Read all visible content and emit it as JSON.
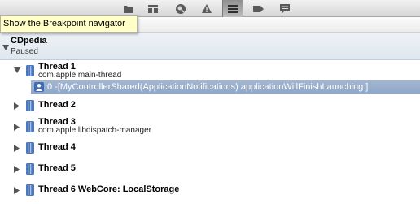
{
  "toolbar": {
    "buttons": [
      {
        "icon": "folder-icon",
        "label": "Project navigator"
      },
      {
        "icon": "hierarchy-icon",
        "label": "Symbol navigator"
      },
      {
        "icon": "search-icon",
        "label": "Search navigator"
      },
      {
        "icon": "warning-icon",
        "label": "Issue navigator"
      },
      {
        "icon": "debug-icon",
        "label": "Debug navigator"
      },
      {
        "icon": "breakpoint-icon",
        "label": "Breakpoint navigator"
      },
      {
        "icon": "log-icon",
        "label": "Log navigator"
      }
    ],
    "active_button": "debug-icon"
  },
  "tooltip": {
    "text": "Show the Breakpoint navigator"
  },
  "process": {
    "name": "CDpedia",
    "state": "Paused"
  },
  "threads": [
    {
      "name": "Thread 1",
      "queue": "com.apple.main-thread",
      "expanded": true
    },
    {
      "name": "Thread 2",
      "queue": "",
      "expanded": false
    },
    {
      "name": "Thread 3",
      "queue": "com.apple.libdispatch-manager",
      "expanded": false
    },
    {
      "name": "Thread 4",
      "queue": "",
      "expanded": false
    },
    {
      "name": "Thread 5",
      "queue": "",
      "expanded": false
    },
    {
      "name": "Thread 6 WebCore: LocalStorage",
      "queue": "",
      "expanded": false
    }
  ],
  "selected_frame": {
    "label": "0 -[MyControllerShared(ApplicationNotifications) applicationWillFinishLaunching:]"
  },
  "colors": {
    "selection": "#98aecd",
    "tooltip_bg": "#ffffc7",
    "thread_icon": "#4a78c0"
  }
}
